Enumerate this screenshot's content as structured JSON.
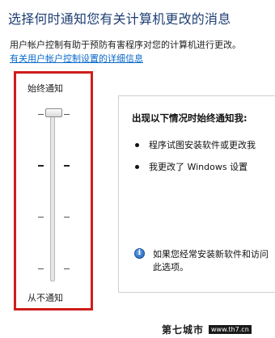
{
  "header": {
    "title": "选择何时通知您有关计算机更改的消息",
    "description": "用户帐户控制有助于预防有害程序对您的计算机进行更改。",
    "learn_more_link": "有关用户帐户控制设置的详细信息"
  },
  "slider": {
    "top_label": "始终通知",
    "bottom_label": "从不通知",
    "levels": 4,
    "selected_level": 4
  },
  "info_panel": {
    "title": "出现以下情况时始终通知我:",
    "bullets": [
      "程序试图安装软件或更改我",
      "我更改了 Windows 设置"
    ],
    "note_line1": "如果您经常安装新软件和访问",
    "note_line2": "此选项。"
  },
  "watermark": {
    "main": "第七城市",
    "url": "www.th7.cn"
  },
  "colors": {
    "title": "#1e3f73",
    "link": "#0b6ac9",
    "highlight": "#d01c1c"
  }
}
